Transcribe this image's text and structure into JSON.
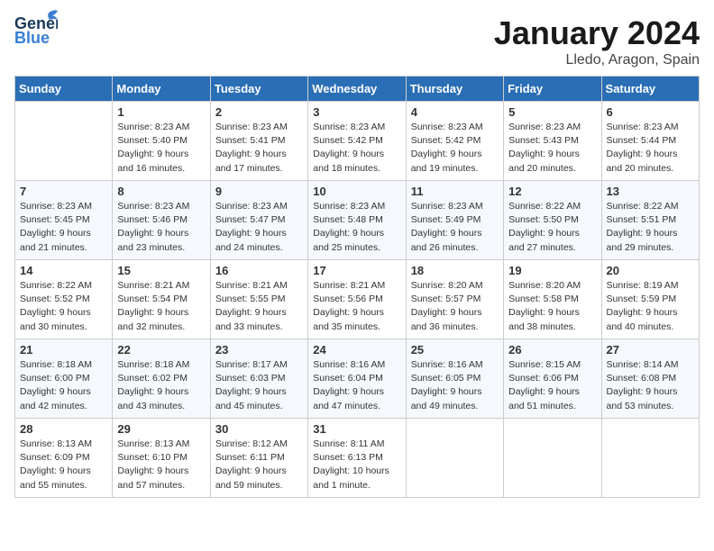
{
  "header": {
    "logo_general": "General",
    "logo_blue": "Blue",
    "month_title": "January 2024",
    "location": "Lledo, Aragon, Spain"
  },
  "days_of_week": [
    "Sunday",
    "Monday",
    "Tuesday",
    "Wednesday",
    "Thursday",
    "Friday",
    "Saturday"
  ],
  "weeks": [
    [
      {
        "day": "",
        "sunrise": "",
        "sunset": "",
        "daylight": ""
      },
      {
        "day": "1",
        "sunrise": "Sunrise: 8:23 AM",
        "sunset": "Sunset: 5:40 PM",
        "daylight": "Daylight: 9 hours and 16 minutes."
      },
      {
        "day": "2",
        "sunrise": "Sunrise: 8:23 AM",
        "sunset": "Sunset: 5:41 PM",
        "daylight": "Daylight: 9 hours and 17 minutes."
      },
      {
        "day": "3",
        "sunrise": "Sunrise: 8:23 AM",
        "sunset": "Sunset: 5:42 PM",
        "daylight": "Daylight: 9 hours and 18 minutes."
      },
      {
        "day": "4",
        "sunrise": "Sunrise: 8:23 AM",
        "sunset": "Sunset: 5:42 PM",
        "daylight": "Daylight: 9 hours and 19 minutes."
      },
      {
        "day": "5",
        "sunrise": "Sunrise: 8:23 AM",
        "sunset": "Sunset: 5:43 PM",
        "daylight": "Daylight: 9 hours and 20 minutes."
      },
      {
        "day": "6",
        "sunrise": "Sunrise: 8:23 AM",
        "sunset": "Sunset: 5:44 PM",
        "daylight": "Daylight: 9 hours and 20 minutes."
      }
    ],
    [
      {
        "day": "7",
        "sunrise": "Sunrise: 8:23 AM",
        "sunset": "Sunset: 5:45 PM",
        "daylight": "Daylight: 9 hours and 21 minutes."
      },
      {
        "day": "8",
        "sunrise": "Sunrise: 8:23 AM",
        "sunset": "Sunset: 5:46 PM",
        "daylight": "Daylight: 9 hours and 23 minutes."
      },
      {
        "day": "9",
        "sunrise": "Sunrise: 8:23 AM",
        "sunset": "Sunset: 5:47 PM",
        "daylight": "Daylight: 9 hours and 24 minutes."
      },
      {
        "day": "10",
        "sunrise": "Sunrise: 8:23 AM",
        "sunset": "Sunset: 5:48 PM",
        "daylight": "Daylight: 9 hours and 25 minutes."
      },
      {
        "day": "11",
        "sunrise": "Sunrise: 8:23 AM",
        "sunset": "Sunset: 5:49 PM",
        "daylight": "Daylight: 9 hours and 26 minutes."
      },
      {
        "day": "12",
        "sunrise": "Sunrise: 8:22 AM",
        "sunset": "Sunset: 5:50 PM",
        "daylight": "Daylight: 9 hours and 27 minutes."
      },
      {
        "day": "13",
        "sunrise": "Sunrise: 8:22 AM",
        "sunset": "Sunset: 5:51 PM",
        "daylight": "Daylight: 9 hours and 29 minutes."
      }
    ],
    [
      {
        "day": "14",
        "sunrise": "Sunrise: 8:22 AM",
        "sunset": "Sunset: 5:52 PM",
        "daylight": "Daylight: 9 hours and 30 minutes."
      },
      {
        "day": "15",
        "sunrise": "Sunrise: 8:21 AM",
        "sunset": "Sunset: 5:54 PM",
        "daylight": "Daylight: 9 hours and 32 minutes."
      },
      {
        "day": "16",
        "sunrise": "Sunrise: 8:21 AM",
        "sunset": "Sunset: 5:55 PM",
        "daylight": "Daylight: 9 hours and 33 minutes."
      },
      {
        "day": "17",
        "sunrise": "Sunrise: 8:21 AM",
        "sunset": "Sunset: 5:56 PM",
        "daylight": "Daylight: 9 hours and 35 minutes."
      },
      {
        "day": "18",
        "sunrise": "Sunrise: 8:20 AM",
        "sunset": "Sunset: 5:57 PM",
        "daylight": "Daylight: 9 hours and 36 minutes."
      },
      {
        "day": "19",
        "sunrise": "Sunrise: 8:20 AM",
        "sunset": "Sunset: 5:58 PM",
        "daylight": "Daylight: 9 hours and 38 minutes."
      },
      {
        "day": "20",
        "sunrise": "Sunrise: 8:19 AM",
        "sunset": "Sunset: 5:59 PM",
        "daylight": "Daylight: 9 hours and 40 minutes."
      }
    ],
    [
      {
        "day": "21",
        "sunrise": "Sunrise: 8:18 AM",
        "sunset": "Sunset: 6:00 PM",
        "daylight": "Daylight: 9 hours and 42 minutes."
      },
      {
        "day": "22",
        "sunrise": "Sunrise: 8:18 AM",
        "sunset": "Sunset: 6:02 PM",
        "daylight": "Daylight: 9 hours and 43 minutes."
      },
      {
        "day": "23",
        "sunrise": "Sunrise: 8:17 AM",
        "sunset": "Sunset: 6:03 PM",
        "daylight": "Daylight: 9 hours and 45 minutes."
      },
      {
        "day": "24",
        "sunrise": "Sunrise: 8:16 AM",
        "sunset": "Sunset: 6:04 PM",
        "daylight": "Daylight: 9 hours and 47 minutes."
      },
      {
        "day": "25",
        "sunrise": "Sunrise: 8:16 AM",
        "sunset": "Sunset: 6:05 PM",
        "daylight": "Daylight: 9 hours and 49 minutes."
      },
      {
        "day": "26",
        "sunrise": "Sunrise: 8:15 AM",
        "sunset": "Sunset: 6:06 PM",
        "daylight": "Daylight: 9 hours and 51 minutes."
      },
      {
        "day": "27",
        "sunrise": "Sunrise: 8:14 AM",
        "sunset": "Sunset: 6:08 PM",
        "daylight": "Daylight: 9 hours and 53 minutes."
      }
    ],
    [
      {
        "day": "28",
        "sunrise": "Sunrise: 8:13 AM",
        "sunset": "Sunset: 6:09 PM",
        "daylight": "Daylight: 9 hours and 55 minutes."
      },
      {
        "day": "29",
        "sunrise": "Sunrise: 8:13 AM",
        "sunset": "Sunset: 6:10 PM",
        "daylight": "Daylight: 9 hours and 57 minutes."
      },
      {
        "day": "30",
        "sunrise": "Sunrise: 8:12 AM",
        "sunset": "Sunset: 6:11 PM",
        "daylight": "Daylight: 9 hours and 59 minutes."
      },
      {
        "day": "31",
        "sunrise": "Sunrise: 8:11 AM",
        "sunset": "Sunset: 6:13 PM",
        "daylight": "Daylight: 10 hours and 1 minute."
      },
      {
        "day": "",
        "sunrise": "",
        "sunset": "",
        "daylight": ""
      },
      {
        "day": "",
        "sunrise": "",
        "sunset": "",
        "daylight": ""
      },
      {
        "day": "",
        "sunrise": "",
        "sunset": "",
        "daylight": ""
      }
    ]
  ]
}
